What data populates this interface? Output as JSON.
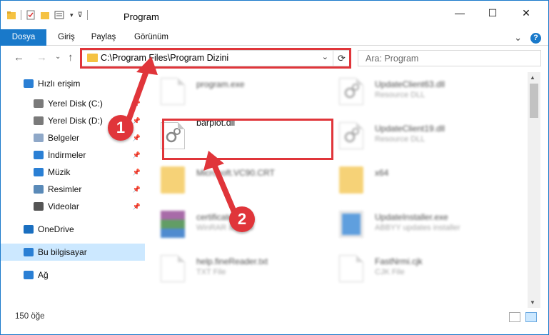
{
  "window": {
    "title": "Program",
    "controls": {
      "minimize": "—",
      "maximize": "☐",
      "close": "✕"
    }
  },
  "ribbon": {
    "tabs": [
      "Dosya",
      "Giriş",
      "Paylaş",
      "Görünüm"
    ],
    "expand_glyph": "⌄",
    "help_glyph": "?"
  },
  "nav": {
    "back_glyph": "←",
    "forward_glyph": "→",
    "recent_glyph": "⌄",
    "up_glyph": "↑",
    "address_path": "C:\\Program Files\\Program Dizini",
    "address_dropdown_glyph": "⌄",
    "refresh_glyph": "⟳",
    "search_placeholder": "Ara: Program"
  },
  "sidebar": {
    "items": [
      {
        "label": "Hızlı erişim",
        "icon": "star-icon",
        "color": "#2a7fd4"
      },
      {
        "label": "Yerel Disk (C:)",
        "icon": "drive-icon",
        "color": "#7a7a7a",
        "pinned": true
      },
      {
        "label": "Yerel Disk (D:)",
        "icon": "drive-icon",
        "color": "#7a7a7a",
        "pinned": true
      },
      {
        "label": "Belgeler",
        "icon": "documents-icon",
        "color": "#8fa8c8",
        "pinned": true
      },
      {
        "label": "İndirmeler",
        "icon": "download-icon",
        "color": "#2a7fd4",
        "pinned": true
      },
      {
        "label": "Müzik",
        "icon": "music-icon",
        "color": "#2a7fd4",
        "pinned": true
      },
      {
        "label": "Resimler",
        "icon": "pictures-icon",
        "color": "#5a8ab8",
        "pinned": true
      },
      {
        "label": "Videolar",
        "icon": "videos-icon",
        "color": "#555555",
        "pinned": true
      },
      {
        "label": "OneDrive",
        "icon": "cloud-icon",
        "color": "#1a6fc0"
      },
      {
        "label": "Bu bilgisayar",
        "icon": "computer-icon",
        "color": "#2a7fd4",
        "selected": true
      },
      {
        "label": "Ağ",
        "icon": "network-icon",
        "color": "#2a7fd4"
      }
    ]
  },
  "files": [
    {
      "name": "program.exe",
      "type": "",
      "icon": "exe-icon",
      "blurred": true
    },
    {
      "name": "UpdateClient63.dll",
      "type": "Resource DLL",
      "icon": "dll-icon",
      "blurred": true
    },
    {
      "name": "barplot.dll",
      "type": "",
      "icon": "dll-icon",
      "blurred": false
    },
    {
      "name": "UpdateClient19.dll",
      "type": "Resource DLL",
      "icon": "dll-icon",
      "blurred": true
    },
    {
      "name": "Microsoft.VC90.CRT",
      "type": "",
      "icon": "folder-icon",
      "blurred": true
    },
    {
      "name": "x64",
      "type": "",
      "icon": "folder-icon",
      "blurred": true
    },
    {
      "name": "certificates.cab",
      "type": "WinRAR archive",
      "icon": "archive-icon",
      "blurred": true
    },
    {
      "name": "UpdateInstaller.exe",
      "type": "ABBYY updates installer",
      "icon": "installer-icon",
      "blurred": true
    },
    {
      "name": "help.fineReader.txt",
      "type": "TXT File",
      "icon": "text-file-icon",
      "blurred": true
    },
    {
      "name": "FastNrmi.cjk",
      "type": "CJK File",
      "icon": "file-icon",
      "blurred": true
    }
  ],
  "status": {
    "item_count": "150 öğe"
  },
  "annotations": {
    "step1": "1",
    "step2": "2",
    "color": "#e0353a"
  }
}
